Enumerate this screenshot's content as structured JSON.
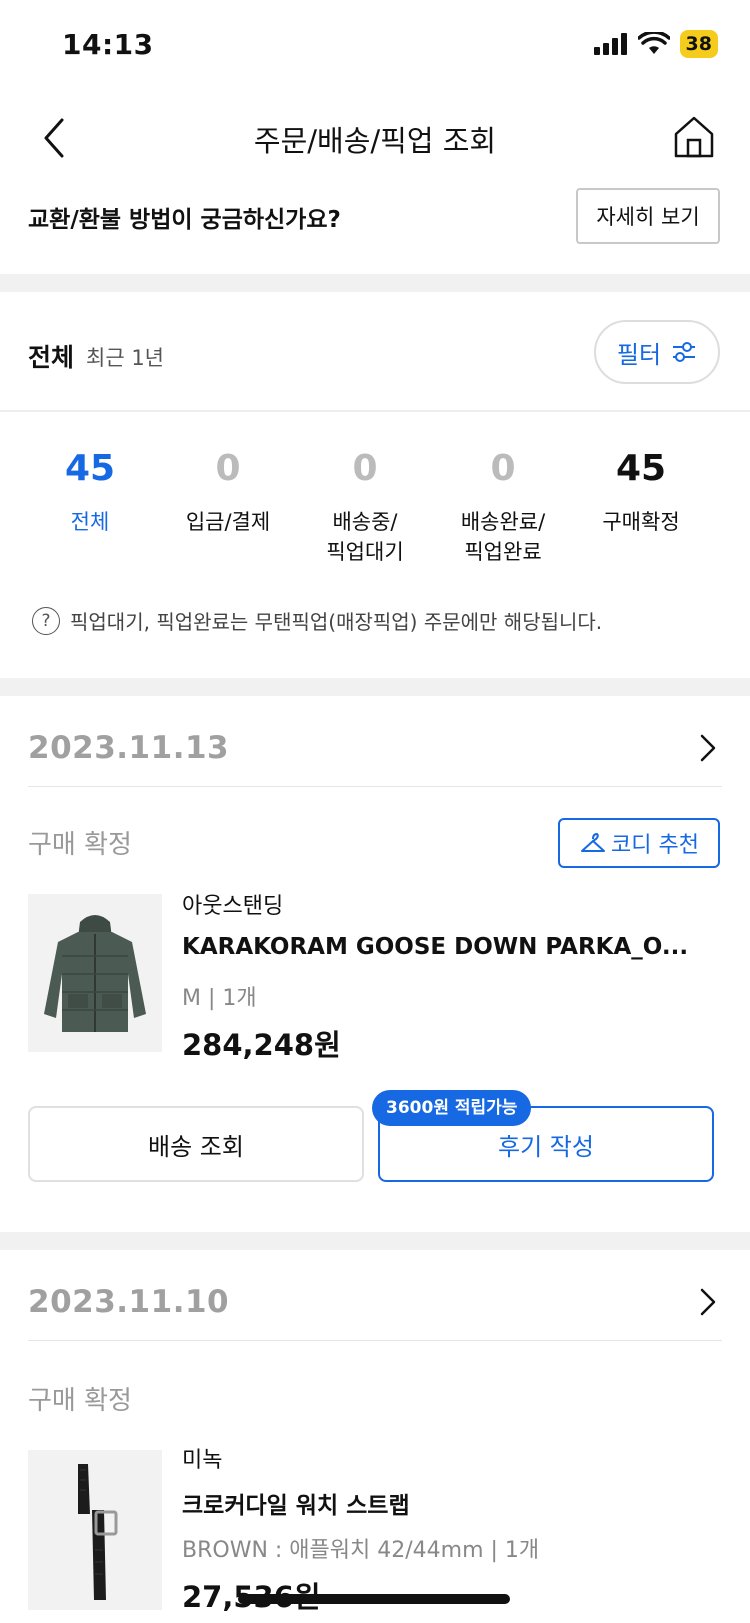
{
  "status_bar": {
    "time": "14:13",
    "battery": "38"
  },
  "header": {
    "title": "주문/배송/픽업 조회"
  },
  "exchange": {
    "text": "교환/환불 방법이 궁금하신가요?",
    "button": "자세히 보기"
  },
  "filter": {
    "label": "전체",
    "sub": "최근 1년",
    "button": "필터"
  },
  "stats": [
    {
      "value": "45",
      "label": "전체"
    },
    {
      "value": "0",
      "label": "입금/결제"
    },
    {
      "value": "0",
      "label": "배송중/\n픽업대기"
    },
    {
      "value": "0",
      "label": "배송완료/\n픽업완료"
    },
    {
      "value": "45",
      "label": "구매확정"
    }
  ],
  "note": "픽업대기, 픽업완료는 무탠픽업(매장픽업) 주문에만 해당됩니다.",
  "orders": [
    {
      "date": "2023.11.13",
      "status": "구매 확정",
      "codi_button": "코디 추천",
      "brand": "아웃스탠딩",
      "name": "KARAKORAM GOOSE DOWN PARKA_O...",
      "option": "M  |  1개",
      "price": "284,248원",
      "delivery_button": "배송 조회",
      "review_button": "후기 작성",
      "badge": "3600원 적립가능"
    },
    {
      "date": "2023.11.10",
      "status": "구매 확정",
      "brand": "미녹",
      "name": "크로커다일 워치 스트랩",
      "option": "BROWN : 애플워치 42/44mm  |  1개",
      "price": "27,536원"
    }
  ],
  "colors": {
    "accent": "#1668e3",
    "muted": "#a0a0a0",
    "battery": "#f5cc1c"
  },
  "icons": [
    "back-chevron-icon",
    "home-icon",
    "filter-icon",
    "question-icon",
    "chevron-right-icon",
    "hanger-icon"
  ]
}
